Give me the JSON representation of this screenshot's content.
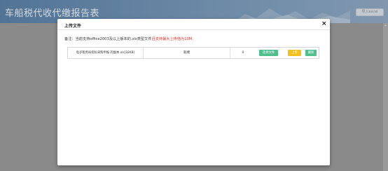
{
  "header": {
    "title": "车船税代收代缴报告表",
    "import_button": "导入excel"
  },
  "scroll": {
    "up_arrow_icon": "chevron-up-icon"
  },
  "modal": {
    "title": "上传文件",
    "close": "×",
    "note_prefix": "备注：当前支持office2003及以上版本的.xls类型文件",
    "note_warning": "且支持最大上传值为10M.",
    "file_row": {
      "file_name": "电子税务局招标采购申报 的副本.xls[32KB]",
      "status": "就绪",
      "progress": "0",
      "choose_label": "选择文件",
      "upload_label": "上传",
      "delete_label": "删除"
    }
  },
  "colors": {
    "header_bar": "#4f7aa5",
    "overlay": "#8a8a8a",
    "warning_text": "#e5281e",
    "green_button": "#4fbf8d",
    "yellow_button": "#f2c11c"
  }
}
